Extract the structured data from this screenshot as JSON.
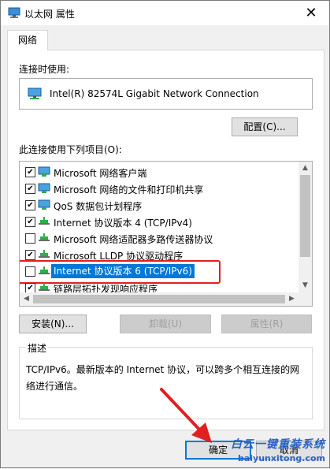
{
  "window": {
    "title": "以太网 属性",
    "close_glyph": "✕"
  },
  "tabs": [
    "网络"
  ],
  "connect_using_label": "连接时使用:",
  "adapter_name": "Intel(R) 82574L Gigabit Network Connection",
  "configure_button": "配置(C)...",
  "items_label": "此连接使用下列项目(O):",
  "items": [
    {
      "label": "Microsoft 网络客户端",
      "checked": true,
      "icon": "network-client-icon"
    },
    {
      "label": "Microsoft 网络的文件和打印机共享",
      "checked": true,
      "icon": "network-client-icon"
    },
    {
      "label": "QoS 数据包计划程序",
      "checked": true,
      "icon": "network-client-icon"
    },
    {
      "label": "Internet 协议版本 4 (TCP/IPv4)",
      "checked": true,
      "icon": "protocol-icon"
    },
    {
      "label": "Microsoft 网络适配器多路传送器协议",
      "checked": false,
      "icon": "protocol-icon"
    },
    {
      "label": "Microsoft LLDP 协议驱动程序",
      "checked": true,
      "icon": "protocol-icon"
    },
    {
      "label": "Internet 协议版本 6 (TCP/IPv6)",
      "checked": false,
      "icon": "protocol-icon",
      "selected": true
    },
    {
      "label": "链路层拓扑发现响应程序",
      "checked": true,
      "icon": "protocol-icon"
    }
  ],
  "install_button": "安装(N)...",
  "uninstall_button": "卸载(U)",
  "properties_button": "属性(R)",
  "description": {
    "title": "描述",
    "text": "TCP/IPv6。最新版本的 Internet 协议，可以跨多个相互连接的网络进行通信。"
  },
  "ok_button": "确定",
  "cancel_button": "取消",
  "watermark": {
    "title": "白云一键重装系统",
    "url": "baiyunxitong.com"
  },
  "colors": {
    "selection": "#0078d7",
    "highlight_box": "#e02020",
    "annotation_arrow": "#e02020",
    "watermark": "#2a63c6"
  }
}
